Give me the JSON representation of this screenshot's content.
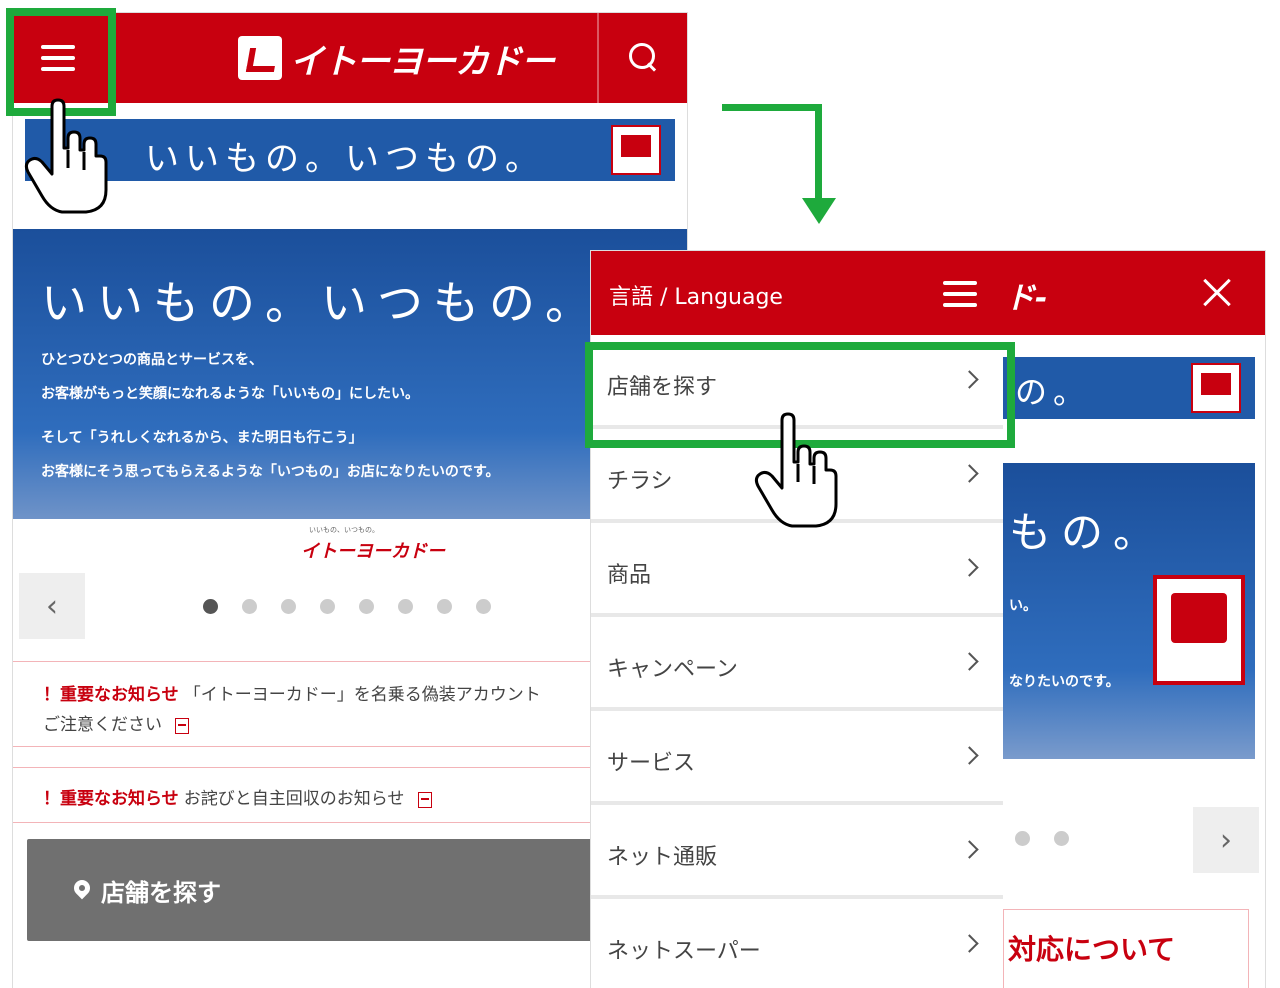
{
  "left_screen": {
    "header": {
      "menu_icon": "hamburger-menu-icon",
      "logo_text": "イトーヨーカドー",
      "search_icon": "search-icon",
      "color": "#c8000f"
    },
    "banner_small": {
      "text": "いいもの。いつもの。"
    },
    "hero": {
      "title": "いいもの。いつもの。",
      "lines": [
        "ひとつひとつの商品とサービスを、",
        "お客様がもっと笑顔になれるような「いいもの」にしたい。",
        "そして「うれしくなれるから、また明日も行こう」",
        "お客様にそう思ってもらえるような「いつもの」お店になりたいのです。"
      ],
      "caption": "いいもの、いつもの。",
      "logo": "イトーヨーカドー"
    },
    "carousel": {
      "prev_label": "‹",
      "dot_count": 8,
      "active_index": 0
    },
    "notices": [
      {
        "label": "！重要なお知らせ",
        "text_line1": "「イトーヨーカドー」を名乗る偽装アカウント",
        "text_line2": "ご注意ください"
      },
      {
        "label": "！重要なお知らせ",
        "text_line1": "お詫びと自主回収のお知らせ"
      }
    ],
    "store_button": {
      "label": "店舗を探す"
    }
  },
  "right_screen": {
    "header": {
      "language_label": "言語 / Language",
      "logo_fragment": "ド-",
      "close_icon": "close-icon"
    },
    "menu_items": [
      {
        "label": "店舗を探す"
      },
      {
        "label": "チラシ"
      },
      {
        "label": "商品"
      },
      {
        "label": "キャンペーン"
      },
      {
        "label": "サービス"
      },
      {
        "label": "ネット通販"
      },
      {
        "label": "ネットスーパー"
      }
    ],
    "background": {
      "band_text": "の。",
      "hero_title": "もの。",
      "hero_line1": "い。",
      "hero_line2": "なりたいのです。",
      "next_label": "›",
      "notice_text": "対応について"
    }
  },
  "annotation": {
    "highlight_color": "#1eaa3c"
  }
}
